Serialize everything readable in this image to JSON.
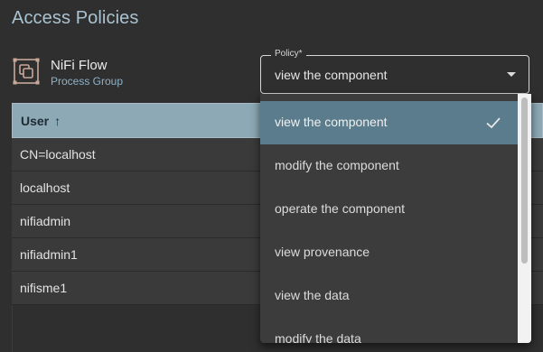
{
  "page_title": "Access Policies",
  "component": {
    "name": "NiFi Flow",
    "type": "Process Group",
    "icon": "process-group-icon"
  },
  "policy_select": {
    "label": "Policy*",
    "value": "view the component"
  },
  "table": {
    "header": "User",
    "sort": "ascending",
    "rows": [
      "CN=localhost",
      "localhost",
      "nifiadmin",
      "nifiadmin1",
      "nifisme1"
    ]
  },
  "dropdown": {
    "options": [
      {
        "label": "view the component",
        "selected": true
      },
      {
        "label": "modify the component",
        "selected": false
      },
      {
        "label": "operate the component",
        "selected": false
      },
      {
        "label": "view provenance",
        "selected": false
      },
      {
        "label": "view the data",
        "selected": false
      },
      {
        "label": "modify the data",
        "selected": false
      }
    ]
  },
  "colors": {
    "background": "#2f2f2f",
    "title": "#a9c3d2",
    "header": "#8da9b6",
    "selected_option": "#5a7c8c",
    "dropdown_bg": "#3c3c3c"
  }
}
